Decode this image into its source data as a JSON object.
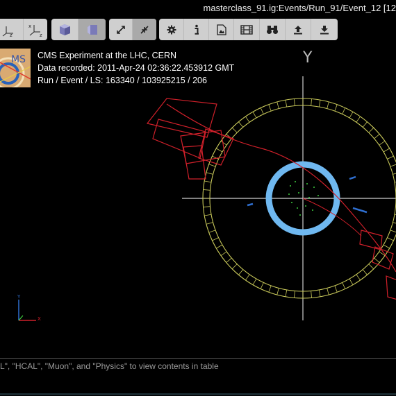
{
  "window": {
    "title": "masterclass_91.ig:Events/Run_91/Event_12 [12"
  },
  "toolbar": {
    "groups": [
      [
        "axes-xz-icon",
        "axes-xyz-icon"
      ],
      [
        "perspective-cube-icon",
        "ortho-cube-icon"
      ],
      [
        "zoom-in-icon",
        "zoom-out-icon"
      ],
      [
        "settings-gear-icon",
        "info-icon",
        "image-export-icon",
        "film-icon",
        "binoculars-icon",
        "upload-icon",
        "download-icon"
      ]
    ]
  },
  "event_info": {
    "line1": "CMS Experiment at the LHC, CERN",
    "line2": "Data recorded: 2011-Apr-24 02:36:22.453912 GMT",
    "line3": "Run / Event / LS: 163340 / 103925215 / 206",
    "logo_text": "MS"
  },
  "view": {
    "axis_label": "Y",
    "mini_axes": {
      "y": "Y",
      "x": "X"
    },
    "colors": {
      "tracker": "#6fb8f0",
      "calorimeter": "#c8c85a",
      "muon": "#d0202a",
      "axis": "#cfcfcf",
      "hits": "#3fcf3f"
    }
  },
  "footer": {
    "help_text": "L\", \"HCAL\", \"Muon\", and \"Physics\" to view contents in table"
  }
}
